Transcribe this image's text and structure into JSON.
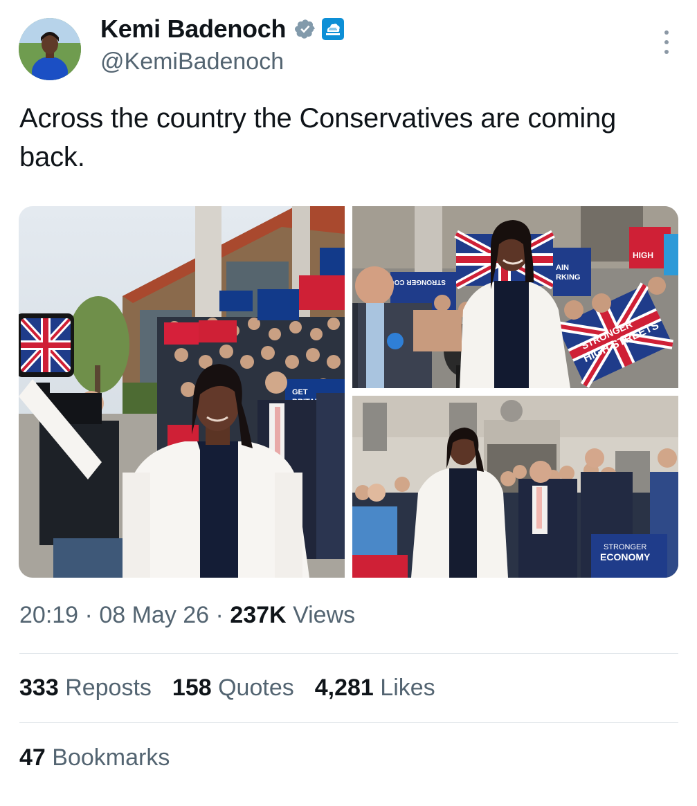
{
  "author": {
    "name": "Kemi Badenoch",
    "handle": "@KemiBadenoch",
    "verified_icon": "verified-badge-icon",
    "affiliation_icon": "conservative-tree-icon"
  },
  "tweet": {
    "text": "Across the country the Conservatives are coming back."
  },
  "media": {
    "photos": [
      {
        "name": "selfie-with-supporters-photo"
      },
      {
        "name": "interview-with-union-flags-photo"
      },
      {
        "name": "group-outside-building-photo"
      }
    ],
    "signs": {
      "p1_sign": "GET BRITAIN WORKING AGAIN",
      "p2_sign_left": "STRONGER COUNTRY",
      "p2_sign_right": "STRONGER HIGH STREETS",
      "p3_sign": "STRONGER ECONOMY"
    }
  },
  "meta": {
    "time": "20:19",
    "date": "08 May 26",
    "separator": "·",
    "views_count": "237K",
    "views_label": "Views"
  },
  "stats": {
    "reposts_count": "333",
    "reposts_label": "Reposts",
    "quotes_count": "158",
    "quotes_label": "Quotes",
    "likes_count": "4,281",
    "likes_label": "Likes",
    "bookmarks_count": "47",
    "bookmarks_label": "Bookmarks"
  },
  "colors": {
    "text": "#0f1419",
    "secondary": "#536471",
    "verified": "#829aab",
    "affiliation": "#0d8fd6",
    "divider": "#e1e6ea"
  }
}
